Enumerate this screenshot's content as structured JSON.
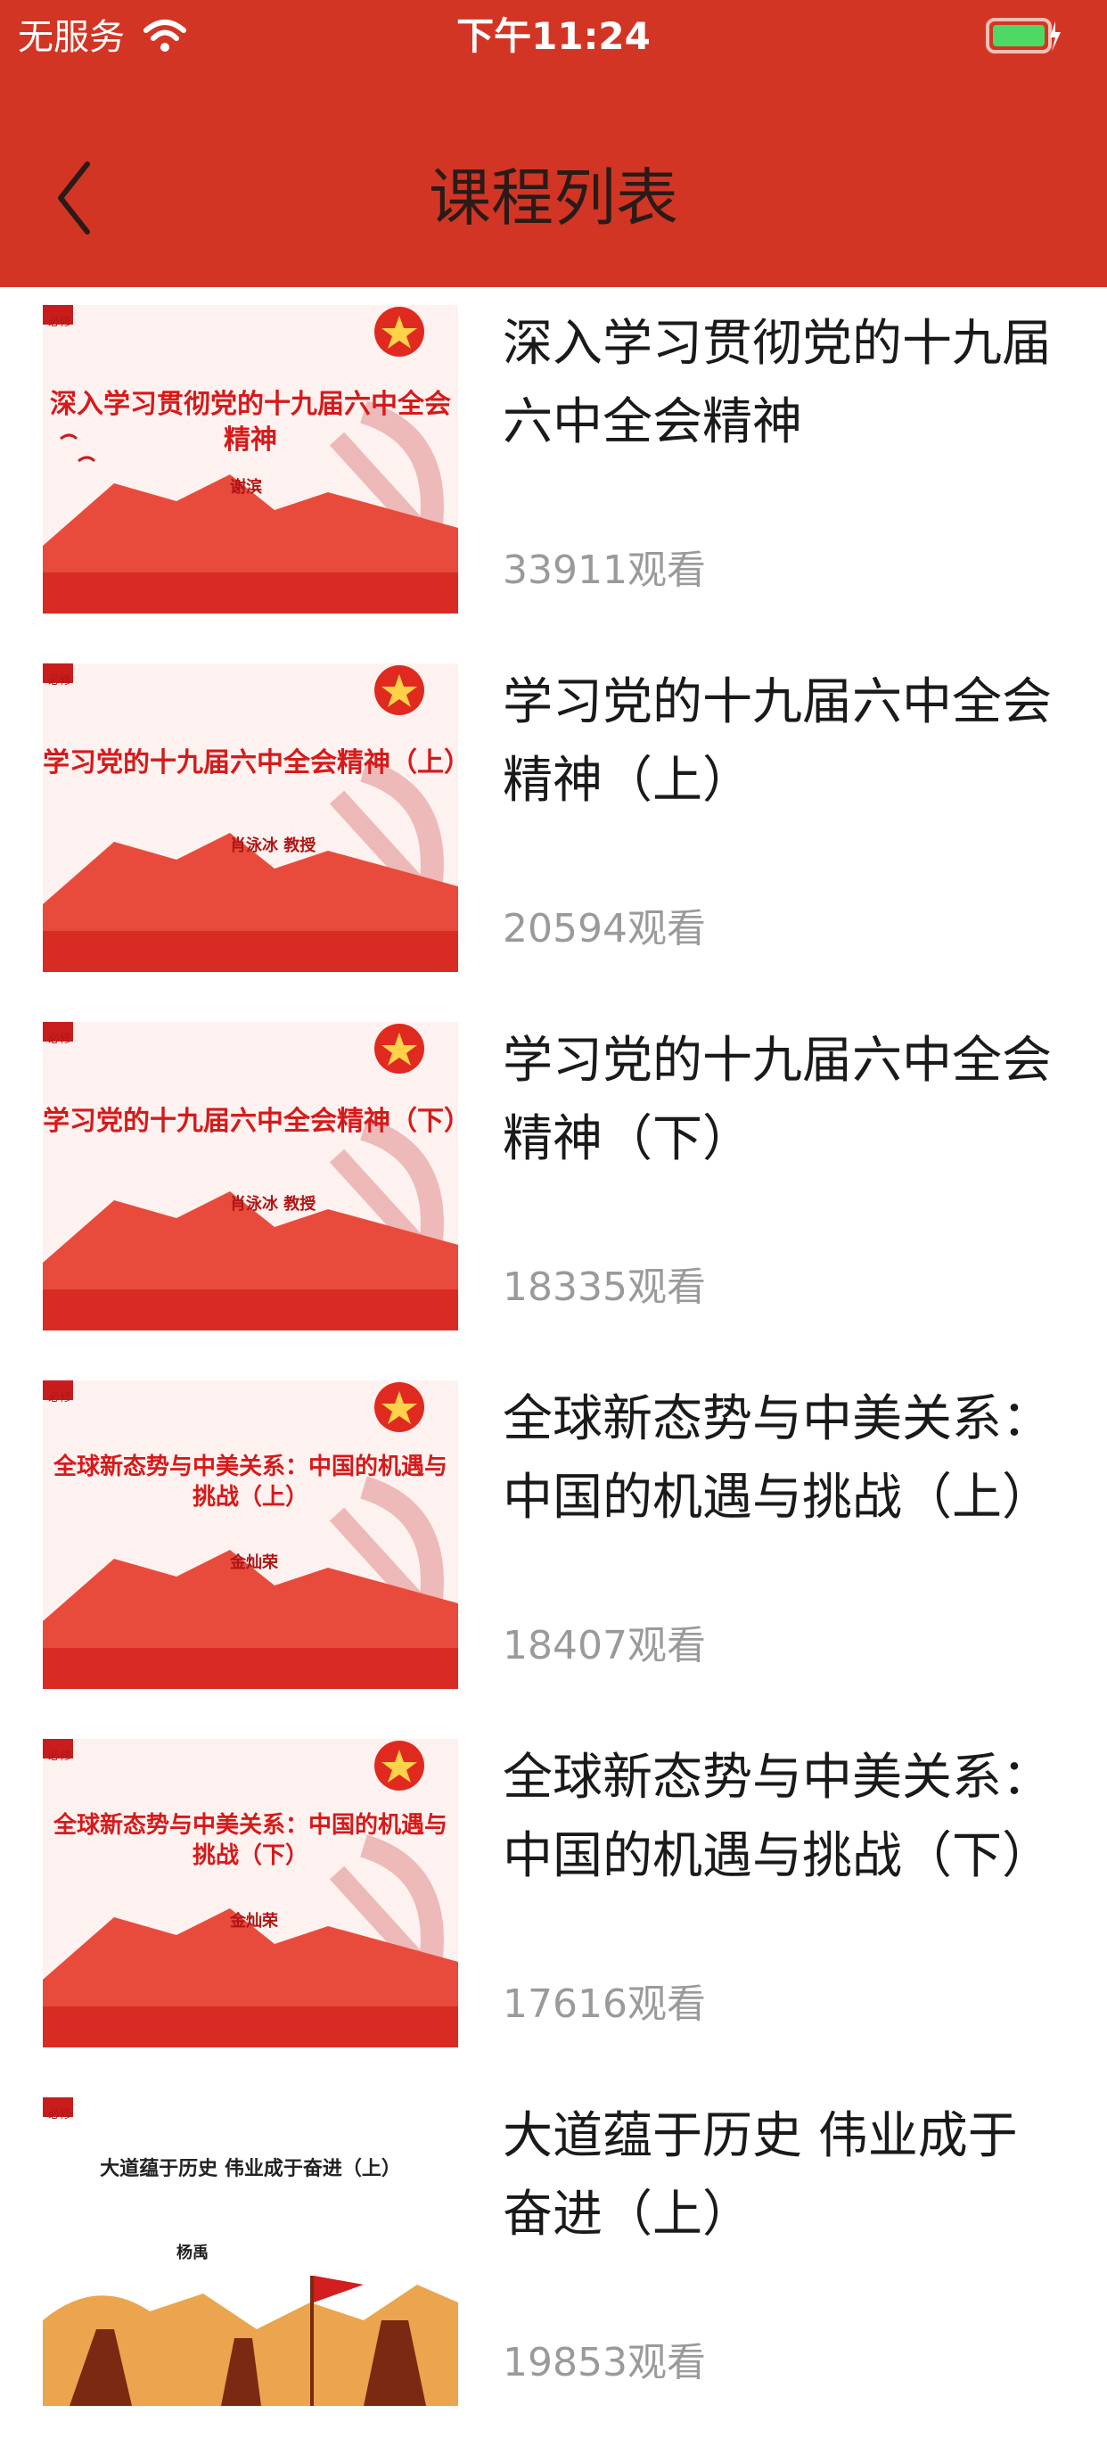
{
  "status_bar": {
    "carrier": "无服务",
    "time": "下午11:24"
  },
  "nav": {
    "title": "课程列表"
  },
  "colors": {
    "bar": "#d33524",
    "title_text": "#1a1a1a",
    "meta_text": "#9a9a9a"
  },
  "courses": [
    {
      "title": "深入学习贯彻党的十九届六中全会精神",
      "views": "33911观看",
      "thumb_title": "深入学习贯彻党的十九届六中全会精神",
      "thumb_name": "谢滨"
    },
    {
      "title": "学习党的十九届六中全会精神（上）",
      "views": "20594观看",
      "thumb_title": "学习党的十九届六中全会精神（上）",
      "thumb_name": "肖泳冰 教授"
    },
    {
      "title": "学习党的十九届六中全会精神（下）",
      "views": "18335观看",
      "thumb_title": "学习党的十九届六中全会精神（下）",
      "thumb_name": "肖泳冰 教授"
    },
    {
      "title": "全球新态势与中美关系：中国的机遇与挑战（上）",
      "views": "18407观看",
      "thumb_title": "全球新态势与中美关系：中国的机遇与挑战（上）",
      "thumb_name": "金灿荣"
    },
    {
      "title": "全球新态势与中美关系：中国的机遇与挑战（下）",
      "views": "17616观看",
      "thumb_title": "全球新态势与中美关系：中国的机遇与挑战（下）",
      "thumb_name": "金灿荣"
    },
    {
      "title": "大道蕴于历史 伟业成于奋进（上）",
      "views": "19853观看",
      "thumb_title": "大道蕴于历史 伟业成于奋进（上）",
      "thumb_name": "杨禹"
    }
  ]
}
